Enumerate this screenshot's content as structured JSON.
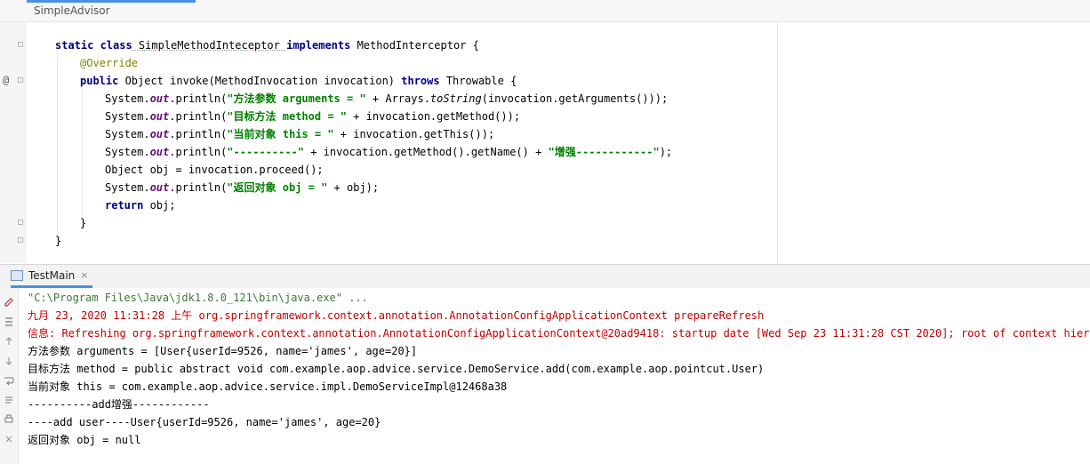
{
  "breadcrumb": {
    "label": "SimpleAdvisor"
  },
  "editor": {
    "gutter_marker": "@",
    "code": {
      "l1": {
        "kw1": "static class",
        "name": " SimpleMethodInteceptor ",
        "kw2": "implements",
        "rest": " MethodInterceptor {"
      },
      "l2": {
        "annotation": "@Override"
      },
      "l3": {
        "kw1": "public",
        "mid": " Object invoke(MethodInvocation invocation) ",
        "kw2": "throws",
        "rest": " Throwable {"
      },
      "l4": {
        "a": "System.",
        "field": "out",
        "b": ".println(",
        "str": "\"方法参数 arguments = \"",
        "c": " + Arrays.",
        "static": "toString",
        "d": "(invocation.getArguments()));"
      },
      "l5": {
        "a": "System.",
        "field": "out",
        "b": ".println(",
        "str": "\"目标方法 method = \"",
        "c": " + invocation.getMethod());"
      },
      "l6": {
        "a": "System.",
        "field": "out",
        "b": ".println(",
        "str": "\"当前对象 this = \"",
        "c": " + invocation.getThis());"
      },
      "l7": {
        "a": "System.",
        "field": "out",
        "b": ".println(",
        "str1": "\"----------\"",
        "c": " + invocation.getMethod().getName() + ",
        "str2": "\"增强------------\"",
        "d": ");"
      },
      "l8": {
        "text": "Object obj = invocation.proceed();"
      },
      "l9": {
        "a": "System.",
        "field": "out",
        "b": ".println(",
        "str": "\"返回对象 obj = \"",
        "c": " + obj);"
      },
      "l10": {
        "kw": "return",
        "rest": " obj;"
      },
      "l11": {
        "text": "}"
      },
      "l12": {
        "text": "}"
      }
    }
  },
  "run": {
    "tab_label": "TestMain",
    "close_glyph": "×"
  },
  "console": {
    "lines": [
      "\"C:\\Program Files\\Java\\jdk1.8.0_121\\bin\\java.exe\" ...",
      "九月 23, 2020 11:31:28 上午 org.springframework.context.annotation.AnnotationConfigApplicationContext prepareRefresh",
      "信息: Refreshing org.springframework.context.annotation.AnnotationConfigApplicationContext@20ad9418: startup date [Wed Sep 23 11:31:28 CST 2020]; root of context hierarchy",
      "方法参数 arguments = [User{userId=9526, name='james', age=20}]",
      "目标方法 method = public abstract void com.example.aop.advice.service.DemoService.add(com.example.aop.pointcut.User)",
      "当前对象 this = com.example.aop.advice.service.impl.DemoServiceImpl@12468a38",
      "----------add增强------------",
      "----add user----User{userId=9526, name='james', age=20}",
      "返回对象 obj = null"
    ]
  },
  "colors": {
    "keyword": "#000080",
    "string": "#008000",
    "annotation": "#808000",
    "field": "#660e7a",
    "console_red": "#c00000",
    "console_cmd": "#3a7a3a",
    "accent": "#4a90e2"
  }
}
